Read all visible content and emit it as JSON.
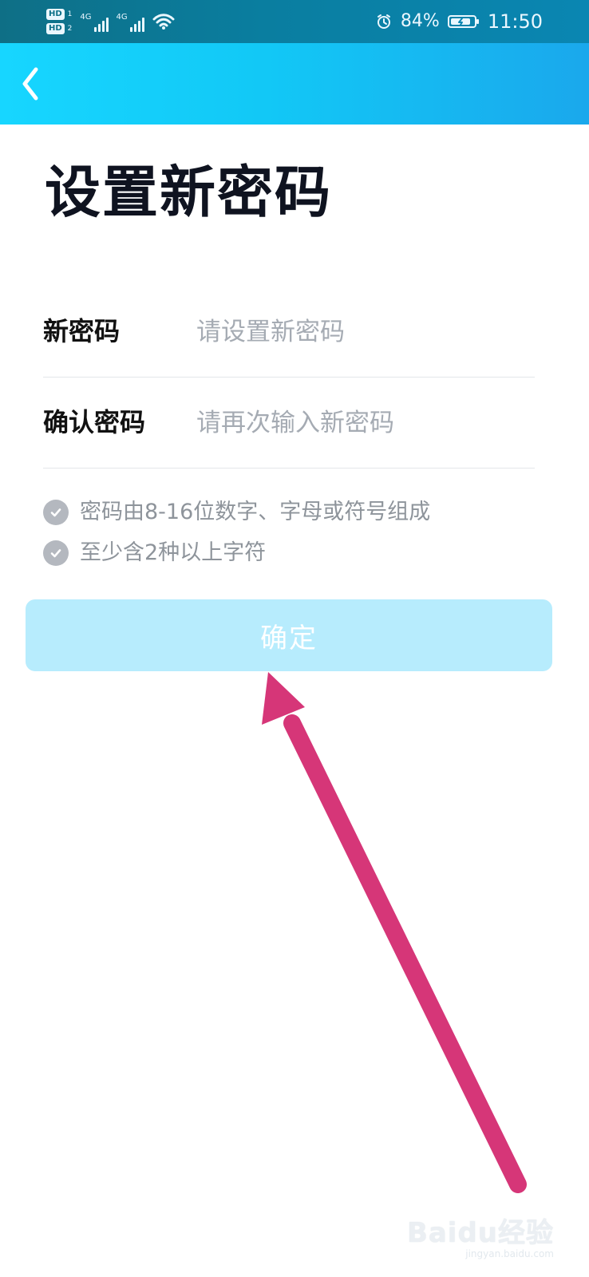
{
  "status_bar": {
    "hd_top": "HD",
    "hd_bottom": "HD",
    "hd_top_sub": "1",
    "hd_bottom_sub": "2",
    "net1": "4G",
    "net2": "4G",
    "battery_percent": "84%",
    "time": "11:50"
  },
  "app_bar": {
    "back_icon": "chevron-left-icon"
  },
  "page": {
    "title": "设置新密码",
    "fields": [
      {
        "label": "新密码",
        "placeholder": "请设置新密码",
        "value": ""
      },
      {
        "label": "确认密码",
        "placeholder": "请再次输入新密码",
        "value": ""
      }
    ],
    "rules": [
      "密码由8-16位数字、字母或符号组成",
      "至少含2种以上字符"
    ],
    "confirm_label": "确定"
  },
  "overlay": {
    "arrow_color": "#d63678"
  },
  "watermark": {
    "logo": "Baidu经验",
    "sub": "jingyan.baidu.com"
  }
}
